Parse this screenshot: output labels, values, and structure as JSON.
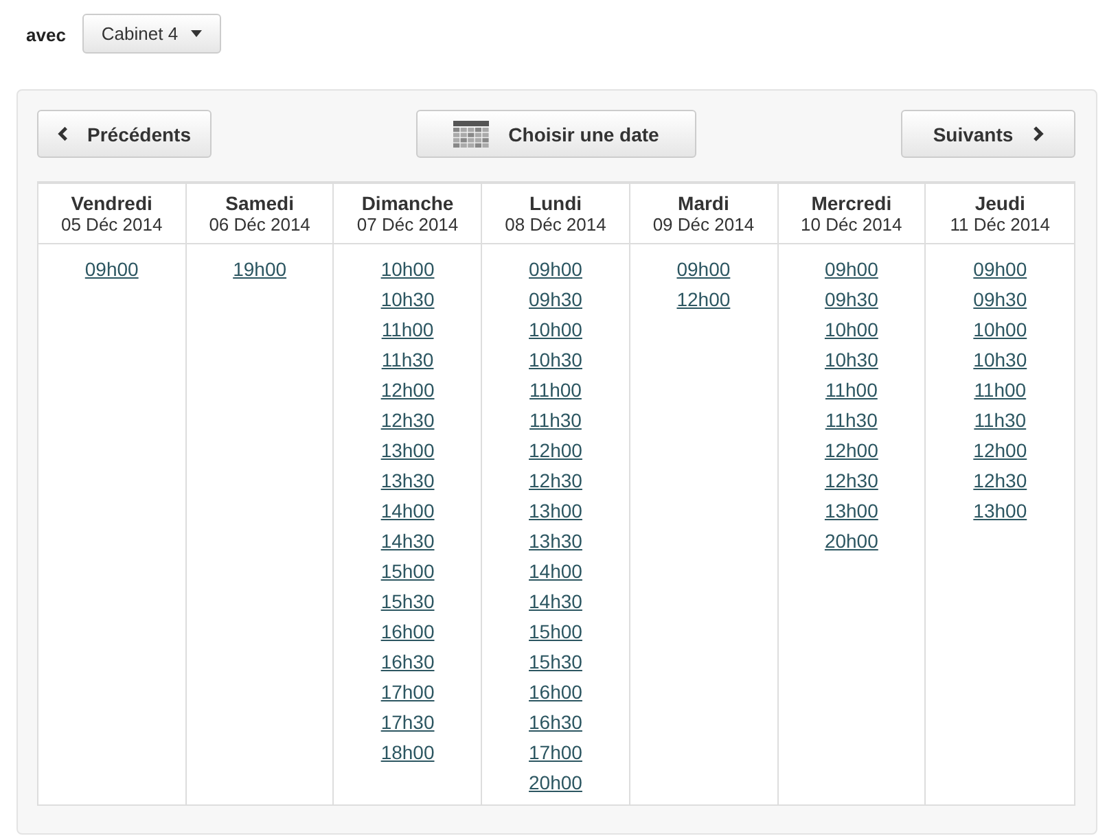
{
  "filter": {
    "label": "avec",
    "dropdown": "Cabinet 4"
  },
  "nav": {
    "previous": "Précédents",
    "pick_date": "Choisir une date",
    "next": "Suivants"
  },
  "days": [
    {
      "name": "Vendredi",
      "date": "05 Déc 2014",
      "slots": [
        "09h00"
      ]
    },
    {
      "name": "Samedi",
      "date": "06 Déc 2014",
      "slots": [
        "19h00"
      ]
    },
    {
      "name": "Dimanche",
      "date": "07 Déc 2014",
      "slots": [
        "10h00",
        "10h30",
        "11h00",
        "11h30",
        "12h00",
        "12h30",
        "13h00",
        "13h30",
        "14h00",
        "14h30",
        "15h00",
        "15h30",
        "16h00",
        "16h30",
        "17h00",
        "17h30",
        "18h00"
      ]
    },
    {
      "name": "Lundi",
      "date": "08 Déc 2014",
      "slots": [
        "09h00",
        "09h30",
        "10h00",
        "10h30",
        "11h00",
        "11h30",
        "12h00",
        "12h30",
        "13h00",
        "13h30",
        "14h00",
        "14h30",
        "15h00",
        "15h30",
        "16h00",
        "16h30",
        "17h00",
        "20h00"
      ]
    },
    {
      "name": "Mardi",
      "date": "09 Déc 2014",
      "slots": [
        "09h00",
        "12h00"
      ]
    },
    {
      "name": "Mercredi",
      "date": "10 Déc 2014",
      "slots": [
        "09h00",
        "09h30",
        "10h00",
        "10h30",
        "11h00",
        "11h30",
        "12h00",
        "12h30",
        "13h00",
        "20h00"
      ]
    },
    {
      "name": "Jeudi",
      "date": "11 Déc 2014",
      "slots": [
        "09h00",
        "09h30",
        "10h00",
        "10h30",
        "11h00",
        "11h30",
        "12h00",
        "12h30",
        "13h00"
      ]
    }
  ]
}
